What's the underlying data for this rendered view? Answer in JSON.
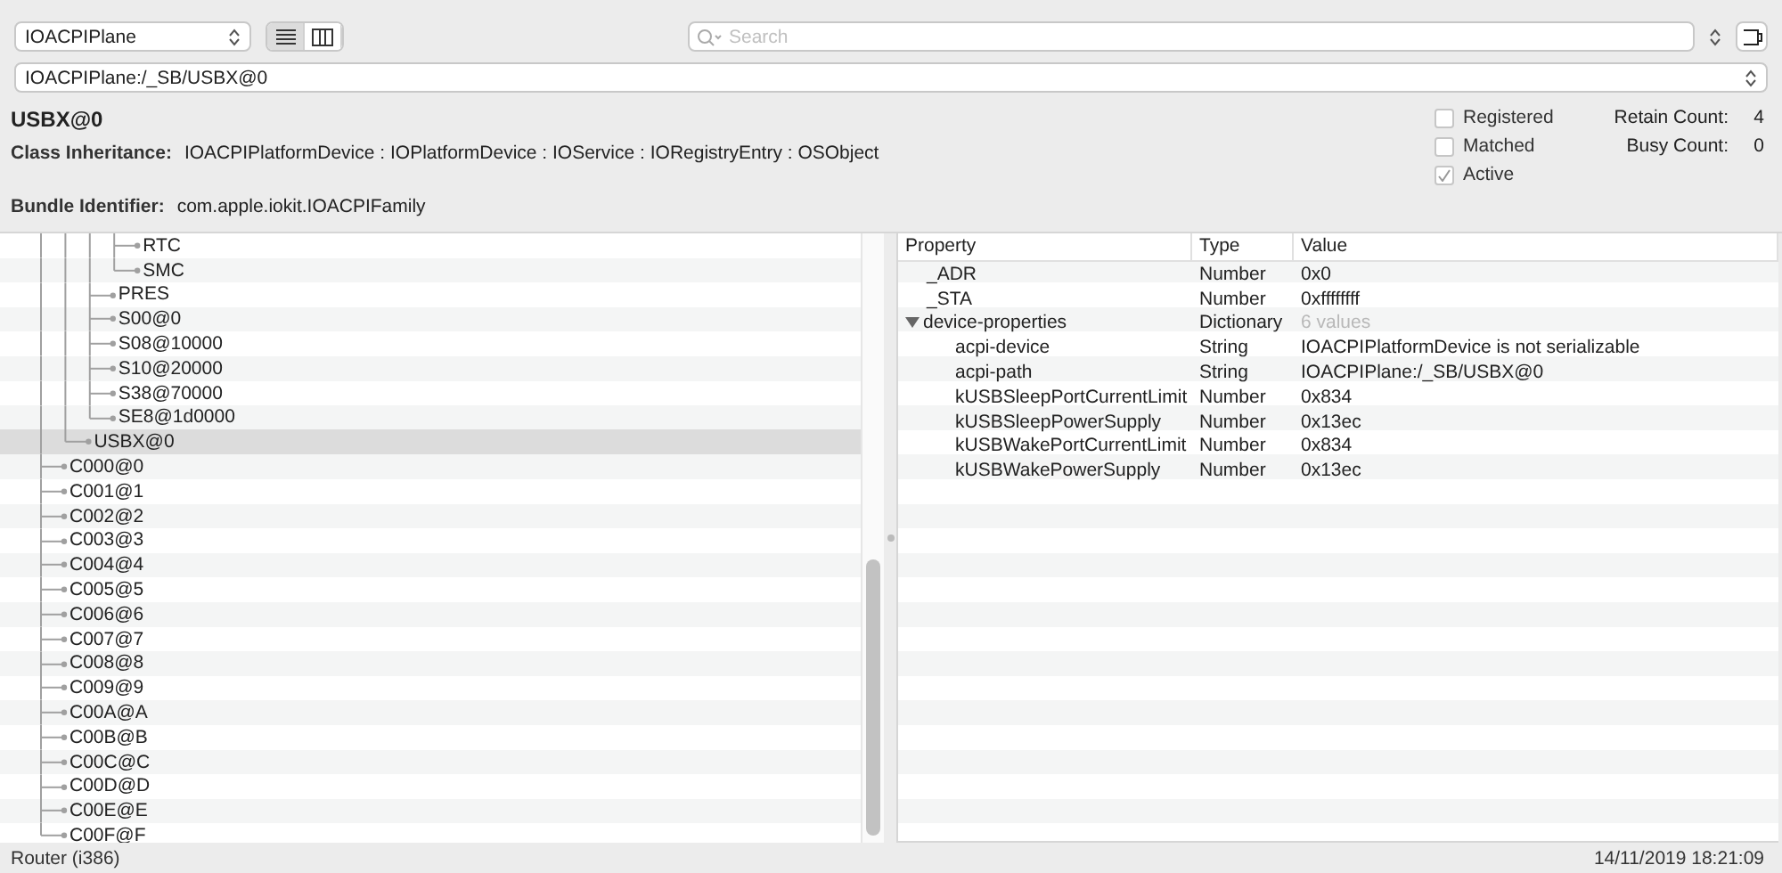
{
  "toolbar": {
    "plane": "IOACPIPlane",
    "view_modes": [
      {
        "kind": "list",
        "selected": true
      },
      {
        "kind": "columns",
        "selected": false
      }
    ],
    "search": {
      "placeholder": "Search"
    }
  },
  "path": "IOACPIPlane:/_SB/USBX@0",
  "object": {
    "name": "USBX@0",
    "class_label": "Class Inheritance:",
    "class_value": "IOACPIPlatformDevice : IOPlatformDevice : IOService : IORegistryEntry : OSObject",
    "bundle_label": "Bundle Identifier:",
    "bundle_value": "com.apple.iokit.IOACPIFamily"
  },
  "flags": [
    {
      "label": "Registered",
      "checked": false
    },
    {
      "label": "Matched",
      "checked": false
    },
    {
      "label": "Active",
      "checked": true
    }
  ],
  "counts": [
    {
      "label": "Retain Count:",
      "value": "4"
    },
    {
      "label": "Busy Count:",
      "value": "0"
    }
  ],
  "tree": [
    {
      "children": [
        {
          "children": [
            {
              "children": [
                {
                  "label": "RTC",
                  "selected": false
                },
                {
                  "label": "SMC",
                  "selected": false
                }
              ]
            },
            {
              "label": "PRES",
              "selected": false
            },
            {
              "label": "S00@0",
              "selected": false
            },
            {
              "label": "S08@10000",
              "selected": false
            },
            {
              "label": "S10@20000",
              "selected": false
            },
            {
              "label": "S38@70000",
              "selected": false
            },
            {
              "label": "SE8@1d0000",
              "selected": false
            }
          ]
        },
        {
          "label": "USBX@0",
          "selected": true
        }
      ]
    },
    {
      "label": "C000@0",
      "selected": false
    },
    {
      "label": "C001@1",
      "selected": false
    },
    {
      "label": "C002@2",
      "selected": false
    },
    {
      "label": "C003@3",
      "selected": false
    },
    {
      "label": "C004@4",
      "selected": false
    },
    {
      "label": "C005@5",
      "selected": false
    },
    {
      "label": "C006@6",
      "selected": false
    },
    {
      "label": "C007@7",
      "selected": false
    },
    {
      "label": "C008@8",
      "selected": false
    },
    {
      "label": "C009@9",
      "selected": false
    },
    {
      "label": "C00A@A",
      "selected": false
    },
    {
      "label": "C00B@B",
      "selected": false
    },
    {
      "label": "C00C@C",
      "selected": false
    },
    {
      "label": "C00D@D",
      "selected": false
    },
    {
      "label": "C00E@E",
      "selected": false
    },
    {
      "label": "C00F@F",
      "selected": false
    }
  ],
  "properties": {
    "columns": [
      "Property",
      "Type",
      "Value"
    ],
    "rows": [
      {
        "property": "_ADR",
        "type": "Number",
        "value": "0x0"
      },
      {
        "property": "_STA",
        "type": "Number",
        "value": "0xffffffff"
      },
      {
        "property": "device-properties",
        "type": "Dictionary",
        "value": "6 values",
        "expanded": true,
        "children": [
          {
            "property": "acpi-device",
            "type": "String",
            "value": "IOACPIPlatformDevice is not serializable"
          },
          {
            "property": "acpi-path",
            "type": "String",
            "value": "IOACPIPlane:/_SB/USBX@0"
          },
          {
            "property": "kUSBSleepPortCurrentLimit",
            "type": "Number",
            "value": "0x834"
          },
          {
            "property": "kUSBSleepPowerSupply",
            "type": "Number",
            "value": "0x13ec"
          },
          {
            "property": "kUSBWakePortCurrentLimit",
            "type": "Number",
            "value": "0x834"
          },
          {
            "property": "kUSBWakePowerSupply",
            "type": "Number",
            "value": "0x13ec"
          }
        ]
      }
    ]
  },
  "status_bar": {
    "left": "Router (i386)",
    "right": "14/11/2019 18:21:09"
  }
}
